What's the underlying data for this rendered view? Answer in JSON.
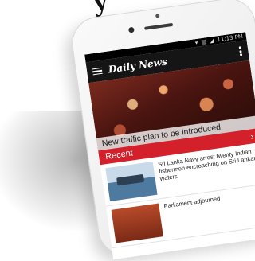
{
  "app": {
    "logo": "Daily News"
  },
  "status_bar": {
    "icons": "▾ ▤ ◢",
    "time": "11:13 PM"
  },
  "hero": {
    "headline": "New traffic plan to be introduced"
  },
  "recent": {
    "label": "Recent",
    "chevron": "›"
  },
  "articles": [
    {
      "title": "Sri Lanka Navy arrest twenty Indian fishermen encroaching on Sri Lankan waters"
    },
    {
      "title": "Parliament adjourned"
    }
  ]
}
